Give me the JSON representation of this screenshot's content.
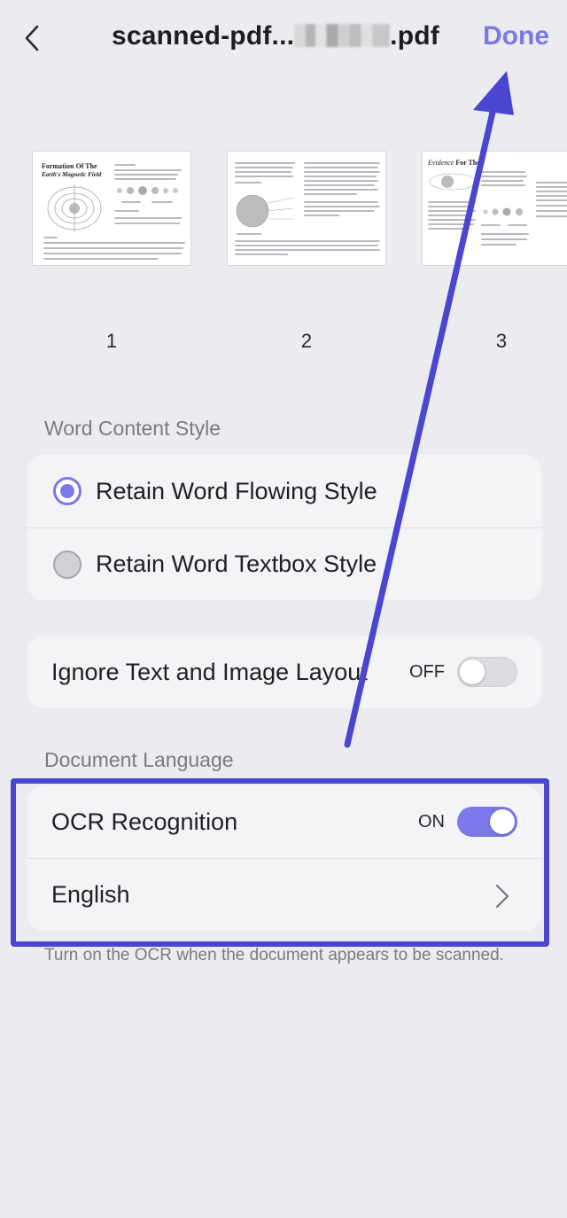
{
  "header": {
    "title_prefix": "scanned-pdf...",
    "title_suffix": ".pdf",
    "done_label": "Done"
  },
  "thumbnails": [
    {
      "page": "1",
      "title": "Formation Of The",
      "subtitle": "Earth's Magnetic Field"
    },
    {
      "page": "2"
    },
    {
      "page": "3",
      "title_italic": "Evidence",
      "title_bold": "For The"
    }
  ],
  "word_style": {
    "section_label": "Word Content Style",
    "options": [
      {
        "label": "Retain Word Flowing Style",
        "selected": true
      },
      {
        "label": "Retain Word Textbox Style",
        "selected": false
      }
    ]
  },
  "layout": {
    "label": "Ignore Text and Image Layout",
    "state": "OFF"
  },
  "language": {
    "section_label": "Document Language",
    "ocr_label": "OCR Recognition",
    "ocr_state": "ON",
    "language_value": "English",
    "helper_text": "Turn on the OCR when the document appears to be scanned."
  },
  "colors": {
    "accent": "#7b78ea",
    "annotation": "#4a46d0",
    "background": "#ececf0"
  }
}
